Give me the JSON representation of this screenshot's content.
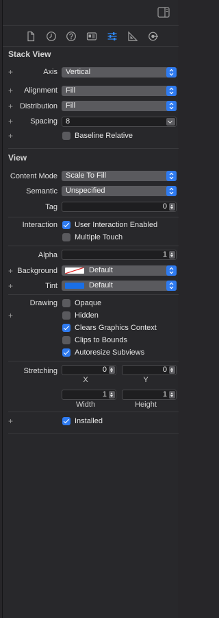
{
  "toolbar": {
    "inspector_toggle_icon": "sidebar-right-icon"
  },
  "tabs": [
    {
      "icon": "file-icon",
      "active": false
    },
    {
      "icon": "clock-icon",
      "active": false
    },
    {
      "icon": "help-icon",
      "active": false
    },
    {
      "icon": "identity-icon",
      "active": false
    },
    {
      "icon": "sliders-icon",
      "active": true
    },
    {
      "icon": "ruler-icon",
      "active": false
    },
    {
      "icon": "connections-icon",
      "active": false
    }
  ],
  "stack_view": {
    "title": "Stack View",
    "axis": {
      "label": "Axis",
      "value": "Vertical"
    },
    "alignment": {
      "label": "Alignment",
      "value": "Fill"
    },
    "distribution": {
      "label": "Distribution",
      "value": "Fill"
    },
    "spacing": {
      "label": "Spacing",
      "value": "8"
    },
    "baseline_relative": {
      "label": "Baseline Relative",
      "checked": false
    }
  },
  "view": {
    "title": "View",
    "content_mode": {
      "label": "Content Mode",
      "value": "Scale To Fill"
    },
    "semantic": {
      "label": "Semantic",
      "value": "Unspecified"
    },
    "tag": {
      "label": "Tag",
      "value": "0"
    },
    "interaction": {
      "label": "Interaction",
      "user_interaction": {
        "label": "User Interaction Enabled",
        "checked": true
      },
      "multiple_touch": {
        "label": "Multiple Touch",
        "checked": false
      }
    },
    "alpha": {
      "label": "Alpha",
      "value": "1"
    },
    "background": {
      "label": "Background",
      "value": "Default",
      "swatch": "none"
    },
    "tint": {
      "label": "Tint",
      "value": "Default",
      "swatch": "#1a6fe6"
    },
    "drawing": {
      "label": "Drawing",
      "opaque": {
        "label": "Opaque",
        "checked": false
      },
      "hidden": {
        "label": "Hidden",
        "checked": false
      },
      "clears_graphics": {
        "label": "Clears Graphics Context",
        "checked": true
      },
      "clips_to_bounds": {
        "label": "Clips to Bounds",
        "checked": false
      },
      "autoresize": {
        "label": "Autoresize Subviews",
        "checked": true
      }
    },
    "stretching": {
      "label": "Stretching",
      "x": {
        "label": "X",
        "value": "0"
      },
      "y": {
        "label": "Y",
        "value": "0"
      },
      "width": {
        "label": "Width",
        "value": "1"
      },
      "height": {
        "label": "Height",
        "value": "1"
      }
    },
    "installed": {
      "label": "Installed",
      "checked": true
    }
  },
  "colors": {
    "accent": "#2f7bf0",
    "panel": "#28282b"
  }
}
